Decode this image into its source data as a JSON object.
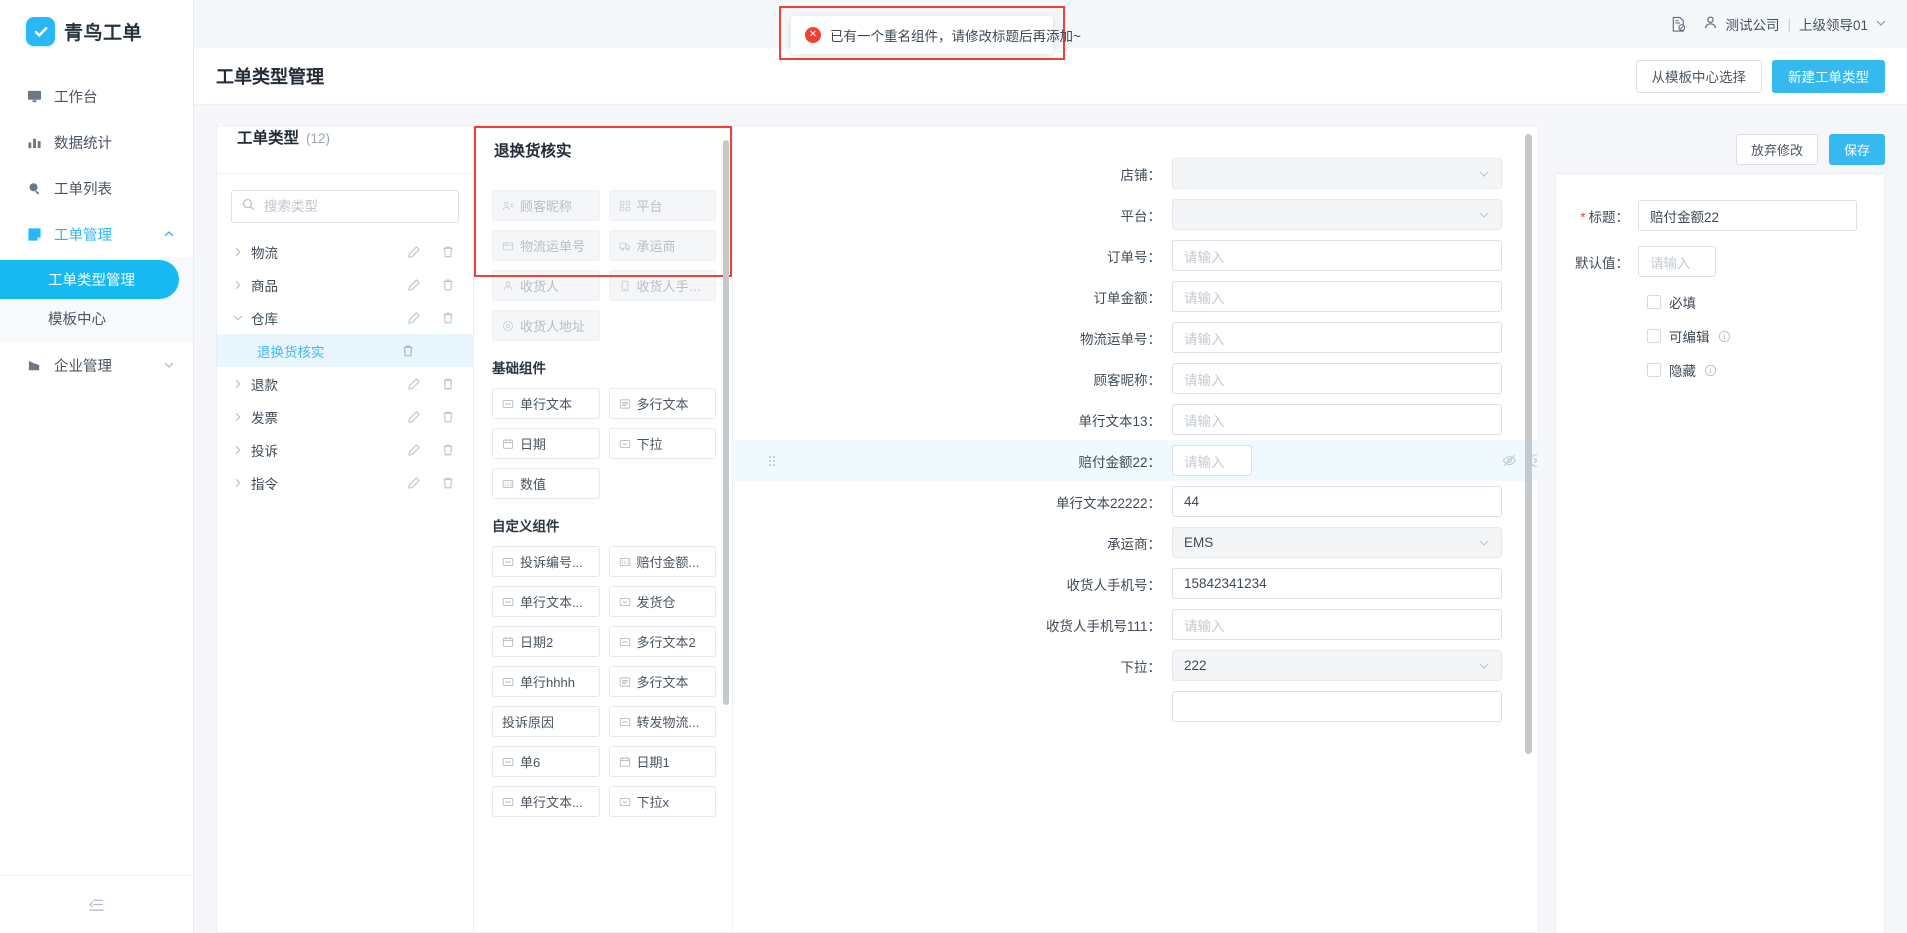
{
  "brand": {
    "name": "青鸟工单",
    "logo_icon": "check-badge-icon",
    "accent": "#29b8f5"
  },
  "sidebar": {
    "items": [
      {
        "label": "工作台",
        "icon": "monitor-icon"
      },
      {
        "label": "数据统计",
        "icon": "bar-chart-icon"
      },
      {
        "label": "工单列表",
        "icon": "search-icon"
      },
      {
        "label": "工单管理",
        "icon": "ticket-icon",
        "expanded": true
      },
      {
        "label": "企业管理",
        "icon": "building-icon",
        "expanded": false
      }
    ],
    "subitems": [
      {
        "label": "工单类型管理",
        "active": true
      },
      {
        "label": "模板中心",
        "active": false
      }
    ],
    "collapse_icon": "collapse-sidebar-icon"
  },
  "topbar": {
    "doc_icon": "document-help-icon",
    "user_icon": "user-icon",
    "company": "测试公司",
    "separator": "|",
    "username": "上级领导01",
    "caret_icon": "chevron-down-icon"
  },
  "toast": {
    "icon": "error-circle-icon",
    "icon_glyph": "✕",
    "message": "已有一个重名组件，请修改标题后再添加~",
    "border_color": "#f04134"
  },
  "page": {
    "title": "工单类型管理",
    "template_button": "从模板中心选择",
    "new_button": "新建工单类型"
  },
  "type_panel": {
    "title": "工单类型",
    "count": "(12)",
    "search_placeholder": "搜索类型",
    "search_icon": "search-icon",
    "edit_icon": "pencil-icon",
    "delete_icon": "trash-icon",
    "nodes": [
      {
        "label": "物流",
        "expanded": false
      },
      {
        "label": "商品",
        "expanded": false
      },
      {
        "label": "仓库",
        "expanded": true
      },
      {
        "label": "退款",
        "expanded": false
      },
      {
        "label": "发票",
        "expanded": false
      },
      {
        "label": "投诉",
        "expanded": false
      },
      {
        "label": "指令",
        "expanded": false
      }
    ],
    "child": {
      "label": "退换货核实",
      "selected": true,
      "parent": "仓库"
    }
  },
  "palette": {
    "title": "退换货核实",
    "used_group": {
      "highlighted": true,
      "items": [
        {
          "label": "顾客昵称",
          "icon": "user-card-icon",
          "disabled": true
        },
        {
          "label": "平台",
          "icon": "grid-icon",
          "disabled": true
        },
        {
          "label": "物流运单号",
          "icon": "parcel-icon",
          "disabled": true
        },
        {
          "label": "承运商",
          "icon": "truck-icon",
          "disabled": true
        },
        {
          "label": "收货人",
          "icon": "user-icon",
          "disabled": true
        },
        {
          "label": "收货人手机号",
          "icon": "phone-icon",
          "disabled": true
        },
        {
          "label": "收货人地址",
          "icon": "location-icon",
          "disabled": true
        }
      ]
    },
    "basic_group": {
      "title": "基础组件",
      "items": [
        {
          "label": "单行文本",
          "icon": "single-line-text-icon"
        },
        {
          "label": "多行文本",
          "icon": "multi-line-text-icon"
        },
        {
          "label": "日期",
          "icon": "calendar-icon"
        },
        {
          "label": "下拉",
          "icon": "dropdown-icon"
        },
        {
          "label": "数值",
          "icon": "number-icon"
        }
      ]
    },
    "custom_group": {
      "title": "自定义组件",
      "items": [
        {
          "label": "投诉编号...",
          "icon": "single-line-text-icon"
        },
        {
          "label": "赔付金额...",
          "icon": "number-icon"
        },
        {
          "label": "单行文本...",
          "icon": "single-line-text-icon"
        },
        {
          "label": "发货仓",
          "icon": "dropdown-icon"
        },
        {
          "label": "日期2",
          "icon": "calendar-icon"
        },
        {
          "label": "多行文本2",
          "icon": "single-line-text-icon"
        },
        {
          "label": "单行hhhh",
          "icon": "single-line-text-icon"
        },
        {
          "label": "多行文本",
          "icon": "multi-line-text-icon"
        },
        {
          "label": "投诉原因",
          "icon": "none"
        },
        {
          "label": "转发物流...",
          "icon": "single-line-text-icon"
        },
        {
          "label": "单6",
          "icon": "single-line-text-icon"
        },
        {
          "label": "日期1",
          "icon": "calendar-icon"
        },
        {
          "label": "单行文本...",
          "icon": "single-line-text-icon"
        },
        {
          "label": "下拉x",
          "icon": "dropdown-icon"
        }
      ]
    }
  },
  "canvas": {
    "placeholder": "请输入",
    "hide_icon": "eye-off-icon",
    "remove_icon": "close-circle-icon",
    "grip_icon": "drag-grip-icon",
    "fields": [
      {
        "label": "店铺",
        "type": "select",
        "value": "",
        "readonly": true,
        "selected": false
      },
      {
        "label": "平台",
        "type": "select",
        "value": "",
        "readonly": true,
        "selected": false
      },
      {
        "label": "订单号",
        "type": "text",
        "value": "",
        "selected": false
      },
      {
        "label": "订单金额",
        "type": "text",
        "value": "",
        "selected": false
      },
      {
        "label": "物流运单号",
        "type": "text",
        "value": "",
        "selected": false
      },
      {
        "label": "顾客昵称",
        "type": "text",
        "value": "",
        "selected": false
      },
      {
        "label": "单行文本13",
        "type": "text",
        "value": "",
        "selected": false
      },
      {
        "label": "赔付金额22",
        "type": "text-narrow",
        "value": "",
        "selected": true
      },
      {
        "label": "单行文本22222",
        "type": "text",
        "value": "44",
        "selected": false
      },
      {
        "label": "承运商",
        "type": "select",
        "value": "EMS",
        "readonly": true,
        "selected": false
      },
      {
        "label": "收货人手机号",
        "type": "text",
        "value": "15842341234",
        "selected": false
      },
      {
        "label": "收货人手机号111",
        "type": "text",
        "value": "",
        "selected": false
      },
      {
        "label": "下拉",
        "type": "select",
        "value": "222",
        "readonly": true,
        "selected": false
      }
    ]
  },
  "props": {
    "discard_button": "放弃修改",
    "save_button": "保存",
    "title_label": "标题",
    "title_value": "赔付金额22",
    "title_required_mark": "*",
    "default_label": "默认值",
    "default_placeholder": "请输入",
    "checkboxes": [
      {
        "label": "必填",
        "checked": false,
        "has_info": false
      },
      {
        "label": "可编辑",
        "checked": false,
        "has_info": true
      },
      {
        "label": "隐藏",
        "checked": false,
        "has_info": true
      }
    ],
    "info_icon": "info-circle-icon"
  }
}
